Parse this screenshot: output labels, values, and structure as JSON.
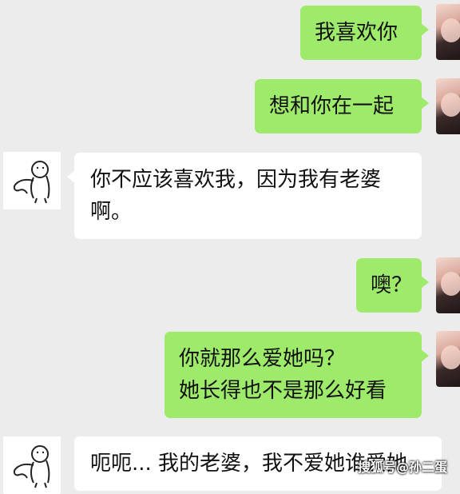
{
  "messages": [
    {
      "sender": "self",
      "lines": [
        "我喜欢你"
      ]
    },
    {
      "sender": "self",
      "lines": [
        "想和你在一起"
      ]
    },
    {
      "sender": "other",
      "lines": [
        "你不应该喜欢我，因为我有老婆",
        "啊。"
      ]
    },
    {
      "sender": "self",
      "lines": [
        "噢？"
      ]
    },
    {
      "sender": "self",
      "lines": [
        "你就那么爱她吗？",
        "她长得也不是那么好看"
      ]
    },
    {
      "sender": "other",
      "lines": [
        "呃呃... 我的老婆，我不爱她谁爱她"
      ]
    }
  ],
  "watermark": "搜狐号@孙二蛋",
  "colors": {
    "self_bubble": "#9eea6a",
    "other_bubble": "#ffffff",
    "background": "#ececec"
  },
  "icons": {
    "self_avatar": "girl-photo-avatar",
    "other_avatar": "doodle-figure-avatar"
  }
}
